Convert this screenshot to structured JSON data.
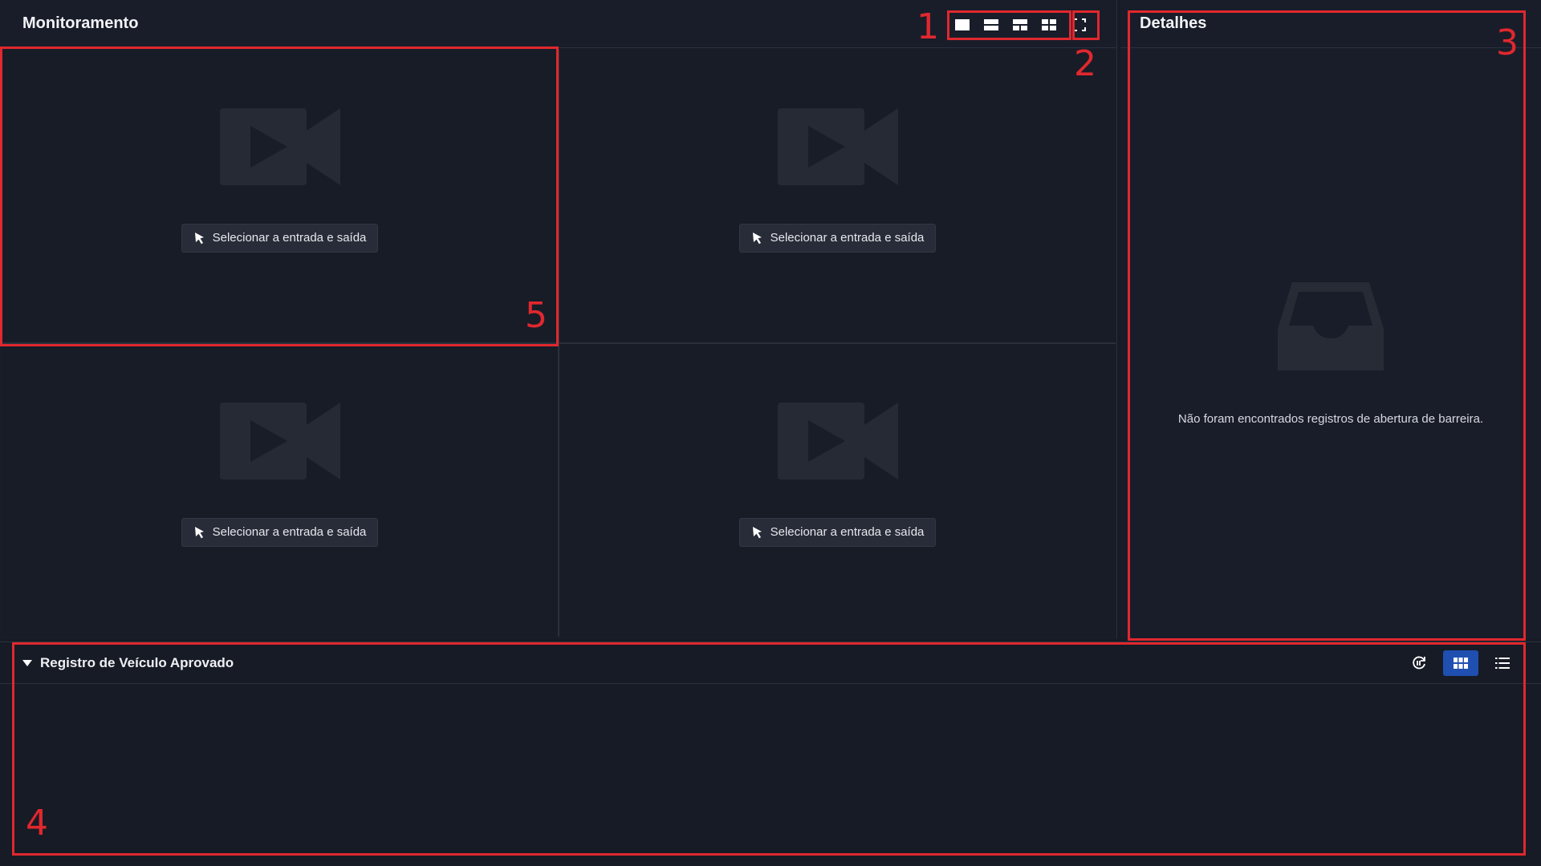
{
  "monitor": {
    "title": "Monitoramento",
    "layout_tools": [
      {
        "name": "layout-1x1-button",
        "icon": "single-view-icon"
      },
      {
        "name": "layout-1x2-button",
        "icon": "two-row-view-icon"
      },
      {
        "name": "layout-1plus2-button",
        "icon": "three-view-icon"
      },
      {
        "name": "layout-2x2-button",
        "icon": "four-view-icon"
      }
    ],
    "fullscreen_icon": "fullscreen-icon",
    "cells": [
      {
        "label": "Selecionar a entrada e saída"
      },
      {
        "label": "Selecionar a entrada e saída"
      },
      {
        "label": "Selecionar a entrada e saída"
      },
      {
        "label": "Selecionar a entrada e saída"
      }
    ]
  },
  "details": {
    "title": "Detalhes",
    "empty_message": "Não foram encontrados registros de abertura de barreira."
  },
  "records": {
    "title": "Registro de Veículo Aprovado",
    "tools": [
      "refresh-icon",
      "grid-view-icon",
      "list-view-icon"
    ]
  },
  "annotations": {
    "n1": "1",
    "n2": "2",
    "n3": "3",
    "n4": "4",
    "n5": "5"
  },
  "colors": {
    "background": "#171b25",
    "panel": "#191d29",
    "accent": "#1f4fb0",
    "annotation": "#e0282e"
  }
}
